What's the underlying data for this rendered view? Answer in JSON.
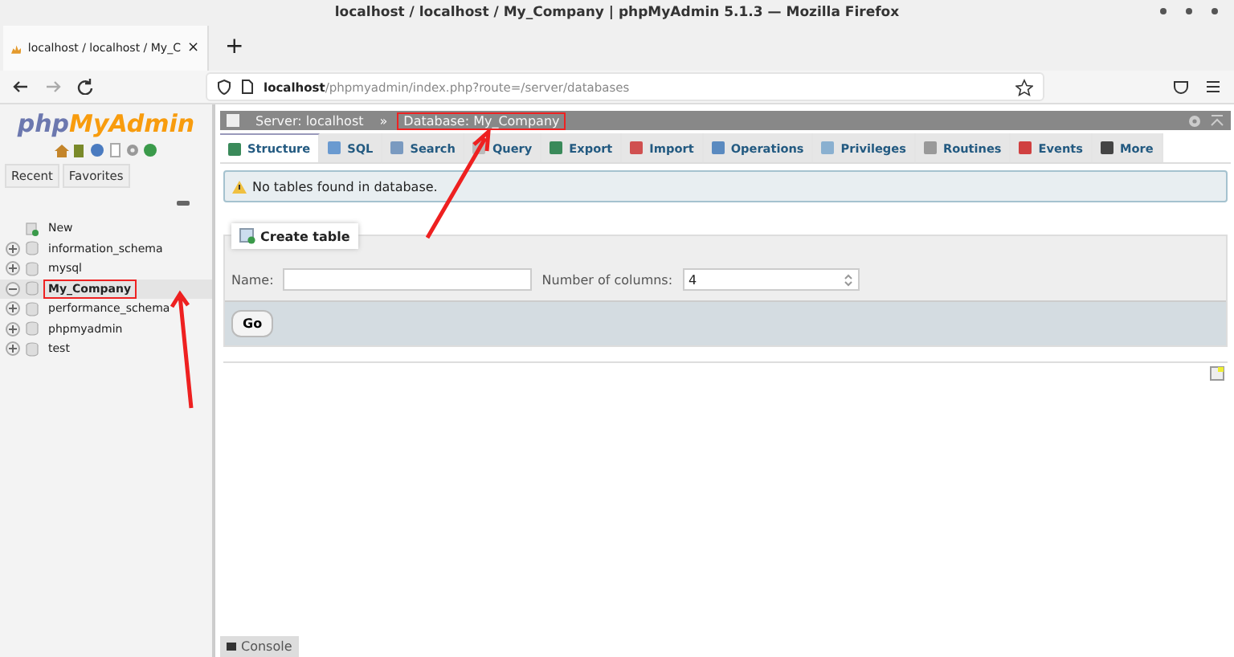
{
  "window": {
    "title": "localhost / localhost / My_Company | phpMyAdmin 5.1.3 — Mozilla Firefox"
  },
  "browser_tab": {
    "label": "localhost / localhost / My_C",
    "close": "×"
  },
  "new_tab": "+",
  "address": {
    "host": "localhost",
    "path": "/phpmyadmin/index.php?route=/server/databases"
  },
  "logo": {
    "part1": "php",
    "part2": "MyAdmin"
  },
  "sidebar_tabs": [
    {
      "label": "Recent",
      "selected": false
    },
    {
      "label": "Favorites",
      "selected": false
    }
  ],
  "tree": [
    {
      "label": "New",
      "kind": "new",
      "highlighted": false,
      "selected": false
    },
    {
      "label": "information_schema",
      "kind": "db",
      "highlighted": false,
      "selected": false
    },
    {
      "label": "mysql",
      "kind": "db",
      "highlighted": false,
      "selected": false
    },
    {
      "label": "My_Company",
      "kind": "db",
      "highlighted": true,
      "selected": true
    },
    {
      "label": "performance_schema",
      "kind": "db",
      "highlighted": false,
      "selected": false
    },
    {
      "label": "phpmyadmin",
      "kind": "db",
      "highlighted": false,
      "selected": false
    },
    {
      "label": "test",
      "kind": "db",
      "highlighted": false,
      "selected": false
    }
  ],
  "breadcrumb": [
    {
      "label": "Server: localhost",
      "highlighted": false
    },
    {
      "label": "Database: My_Company",
      "highlighted": true
    }
  ],
  "breadcrumb_separator": "»",
  "tabs": [
    {
      "label": "Structure",
      "selected": true
    },
    {
      "label": "SQL",
      "selected": false
    },
    {
      "label": "Search",
      "selected": false
    },
    {
      "label": "Query",
      "selected": false
    },
    {
      "label": "Export",
      "selected": false
    },
    {
      "label": "Import",
      "selected": false
    },
    {
      "label": "Operations",
      "selected": false
    },
    {
      "label": "Privileges",
      "selected": false
    },
    {
      "label": "Routines",
      "selected": false
    },
    {
      "label": "Events",
      "selected": false
    },
    {
      "label": "More",
      "selected": false
    }
  ],
  "notice": "No tables found in database.",
  "create_table": {
    "legend": "Create table",
    "name_label": "Name:",
    "columns_label": "Number of columns:",
    "columns_value": "4",
    "go": "Go"
  },
  "console": "Console"
}
